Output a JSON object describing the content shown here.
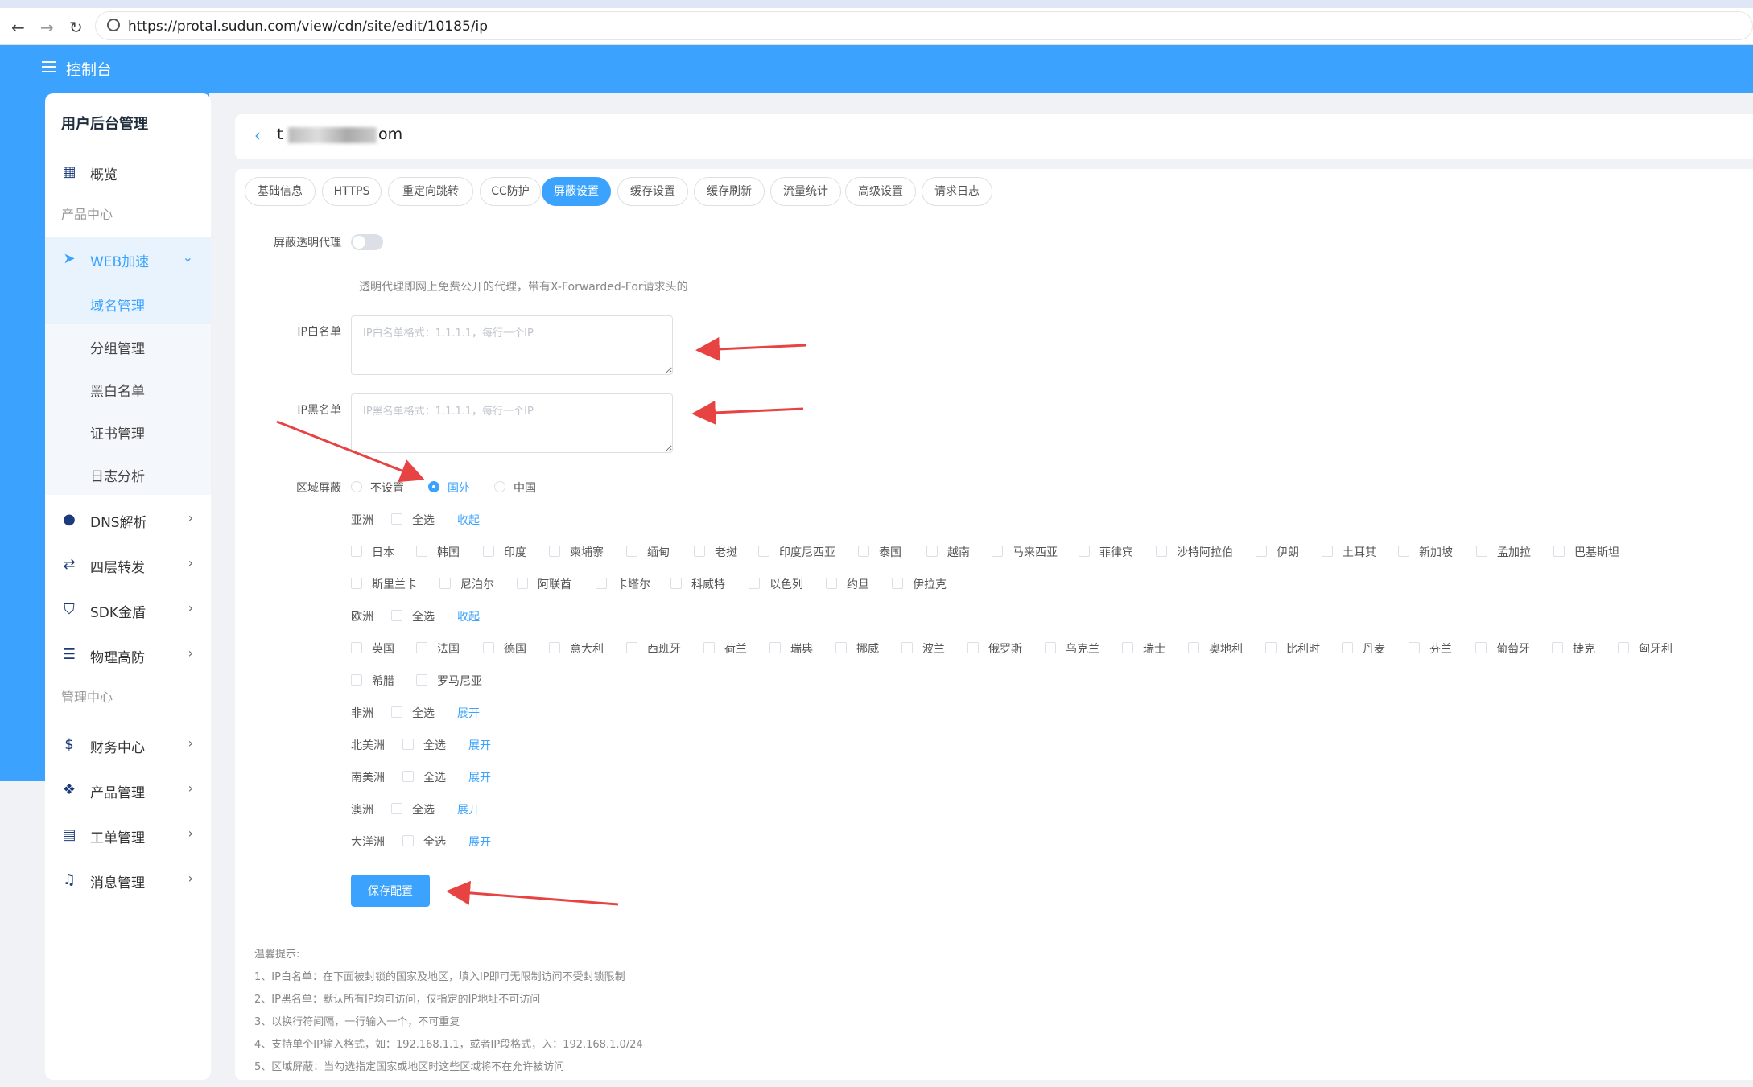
{
  "browser": {
    "url": "https://protal.sudun.com/view/cdn/site/edit/10185/ip"
  },
  "header": {
    "title": "控制台"
  },
  "sidebar": {
    "heading": "用户后台管理",
    "overview": "概览",
    "section_product": "产品中心",
    "web_accel": "WEB加速",
    "sub": [
      "域名管理",
      "分组管理",
      "黑白名单",
      "证书管理",
      "日志分析"
    ],
    "dns": "DNS解析",
    "l4": "四层转发",
    "sdk": "SDK金盾",
    "phys": "物理高防",
    "section_manage": "管理中心",
    "finance": "财务中心",
    "products": "产品管理",
    "tickets": "工单管理",
    "messages": "消息管理"
  },
  "main": {
    "domain_prefix": "t",
    "domain_suffix": "om",
    "tabs": [
      "基础信息",
      "HTTPS",
      "重定向跳转",
      "CC防护",
      "屏蔽设置",
      "缓存设置",
      "缓存刷新",
      "流量统计",
      "高级设置",
      "请求日志"
    ],
    "active_tab": "屏蔽设置",
    "proxy_label": "屏蔽透明代理",
    "proxy_hint": "透明代理即网上免费公开的代理，带有X-Forwarded-For请求头的",
    "whitelist_label": "IP白名单",
    "whitelist_placeholder": "IP白名单格式：1.1.1.1，每行一个IP",
    "blacklist_label": "IP黑名单",
    "blacklist_placeholder": "IP黑名单格式：1.1.1.1，每行一个IP",
    "region_label": "区域屏蔽",
    "region_options": [
      "不设置",
      "国外",
      "中国"
    ],
    "select_all": "全选",
    "collapse": "收起",
    "expand": "展开",
    "asia": "亚洲",
    "asia_countries_1": [
      "日本",
      "韩国",
      "印度",
      "柬埔寨",
      "缅甸",
      "老挝",
      "印度尼西亚",
      "泰国",
      "越南",
      "马来西亚",
      "菲律宾",
      "沙特阿拉伯",
      "伊朗",
      "土耳其",
      "新加坡",
      "孟加拉",
      "巴基斯坦"
    ],
    "asia_countries_2": [
      "斯里兰卡",
      "尼泊尔",
      "阿联酋",
      "卡塔尔",
      "科威特",
      "以色列",
      "约旦",
      "伊拉克"
    ],
    "europe": "欧洲",
    "europe_countries_1": [
      "英国",
      "法国",
      "德国",
      "意大利",
      "西班牙",
      "荷兰",
      "瑞典",
      "挪威",
      "波兰",
      "俄罗斯",
      "乌克兰",
      "瑞士",
      "奥地利",
      "比利时",
      "丹麦",
      "芬兰",
      "葡萄牙",
      "捷克",
      "匈牙利"
    ],
    "europe_countries_2": [
      "希腊",
      "罗马尼亚"
    ],
    "africa": "非洲",
    "north_america": "北美洲",
    "south_america": "南美洲",
    "australia": "澳洲",
    "oceania": "大洋洲",
    "save": "保存配置",
    "tips_title": "温馨提示:",
    "tips": [
      "1、IP白名单：在下面被封锁的国家及地区，填入IP即可无限制访问不受封锁限制",
      "2、IP黑名单：默认所有IP均可访问，仅指定的IP地址不可访问",
      "3、以换行符间隔，一行输入一个，不可重复",
      "4、支持单个IP输入格式，如：192.168.1.1，或者IP段格式，入：192.168.1.0/24",
      "5、区域屏蔽：当勾选指定国家或地区时这些区域将不在允许被访问"
    ]
  },
  "colors": {
    "accent": "#3ba3fd",
    "annotation_arrow": "#e84343"
  }
}
